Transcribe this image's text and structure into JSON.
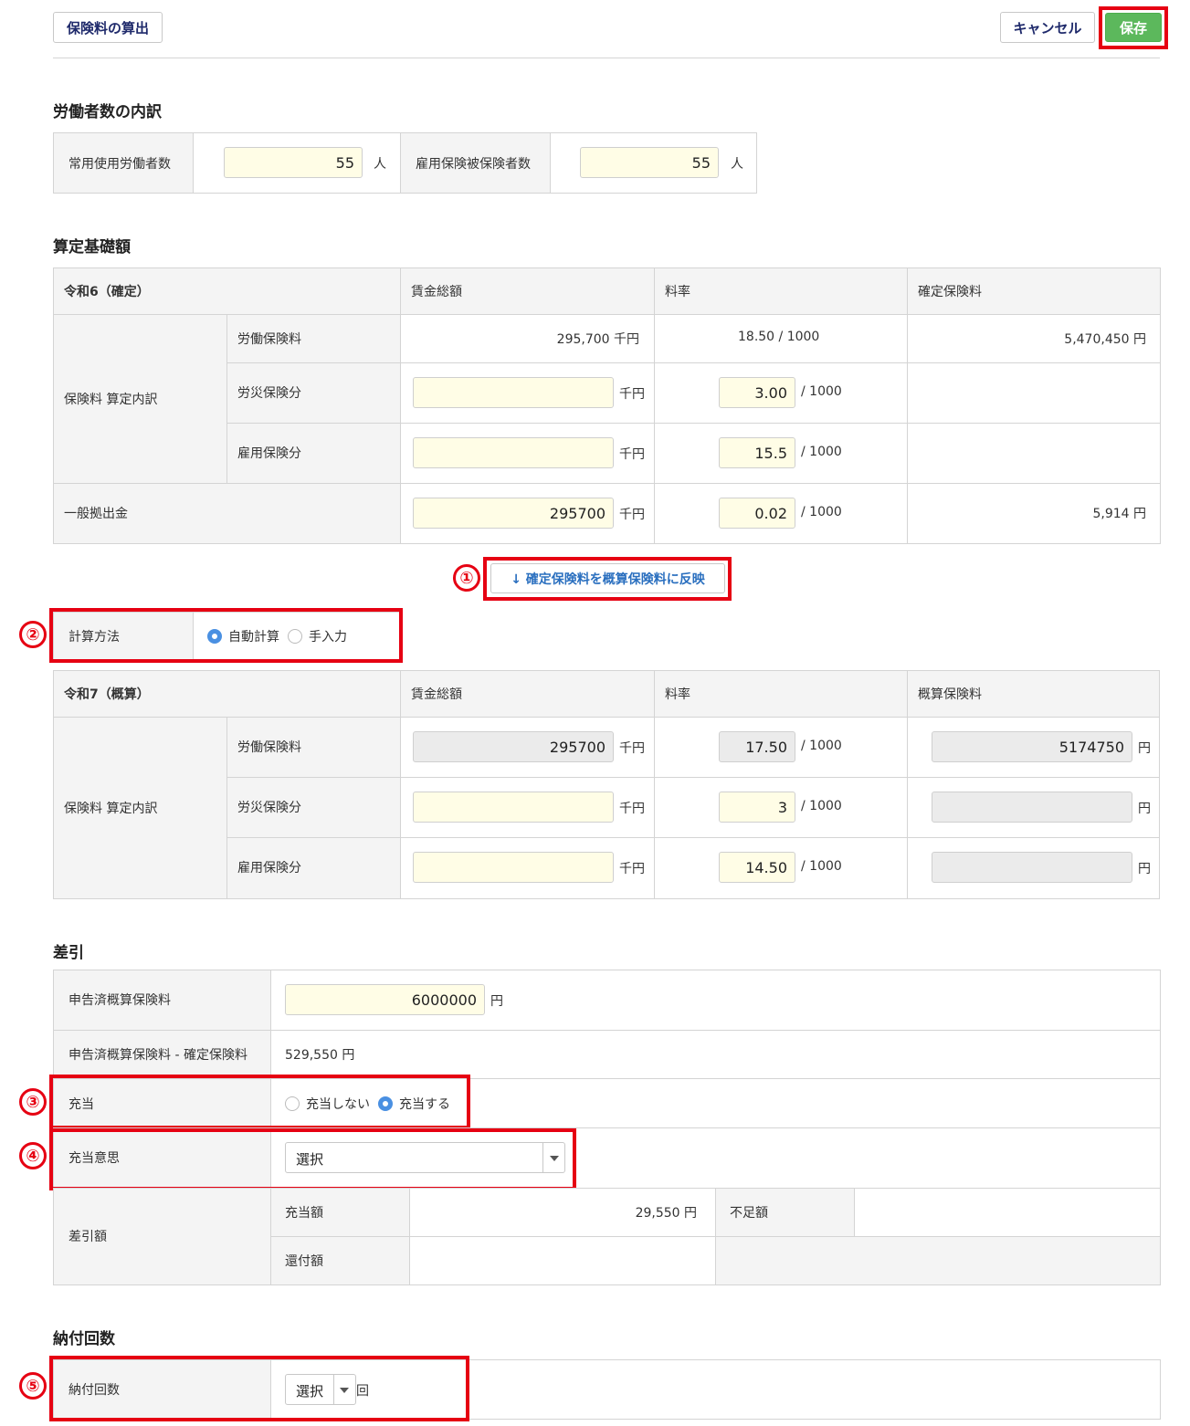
{
  "toolbar": {
    "calc_label": "保険料の算出",
    "cancel_label": "キャンセル",
    "save_label": "保存"
  },
  "workers": {
    "title": "労働者数の内訳",
    "regular_label": "常用使用労働者数",
    "regular_value": "55",
    "unit_person": "人",
    "insured_label": "雇用保険被保険者数",
    "insured_value": "55"
  },
  "basis": {
    "title": "算定基礎額",
    "year_label": "令和6（確定）",
    "col_wage": "賃金総額",
    "col_rate": "料率",
    "col_premium": "確定保険料",
    "group_label": "保険料 算定内訳",
    "labor_label": "労働保険料",
    "labor_wage": "295,700 千円",
    "labor_rate": "18.50 / 1000",
    "labor_premium": "5,470,450 円",
    "workcomp_label": "労災保険分",
    "workcomp_wage": "",
    "workcomp_rate": "3.00",
    "employ_label": "雇用保険分",
    "employ_wage": "",
    "employ_rate": "15.5",
    "general_label": "一般拠出金",
    "general_wage": "295700",
    "general_rate": "0.02",
    "general_premium": "5,914 円",
    "unit_thousand_yen": "千円",
    "unit_per_1000": "/ 1000"
  },
  "reflect": {
    "label": "↓ 確定保険料を概算保険料に反映"
  },
  "calc_method": {
    "label": "計算方法",
    "auto": "自動計算",
    "manual": "手入力"
  },
  "estimate": {
    "year_label": "令和7（概算）",
    "col_wage": "賃金総額",
    "col_rate": "料率",
    "col_premium": "概算保険料",
    "group_label": "保険料 算定内訳",
    "labor_label": "労働保険料",
    "labor_wage": "295700",
    "labor_rate": "17.50",
    "labor_premium": "5174750",
    "workcomp_label": "労災保険分",
    "workcomp_rate": "3",
    "employ_label": "雇用保険分",
    "employ_rate": "14.50",
    "unit_yen": "円"
  },
  "diff": {
    "title": "差引",
    "declared_label": "申告済概算保険料",
    "declared_value": "6000000",
    "declared_unit": "円",
    "minus_label": "申告済概算保険料 - 確定保険料",
    "minus_value": "529,550 円",
    "allot_label": "充当",
    "allot_no": "充当しない",
    "allot_yes": "充当する",
    "intent_label": "充当意思",
    "intent_value": "選択",
    "net_label": "差引額",
    "allot_amount_label": "充当額",
    "allot_amount_value": "29,550 円",
    "shortfall_label": "不足額",
    "refund_label": "還付額"
  },
  "payment": {
    "title": "納付回数",
    "label": "納付回数",
    "value": "選択",
    "unit": "回"
  },
  "markers": [
    "①",
    "②",
    "③",
    "④",
    "⑤"
  ],
  "colors": {
    "accent_red": "#e60012",
    "save_green": "#5cb85c",
    "input_yellow": "#fffde6",
    "radio_blue": "#4a90e2"
  }
}
